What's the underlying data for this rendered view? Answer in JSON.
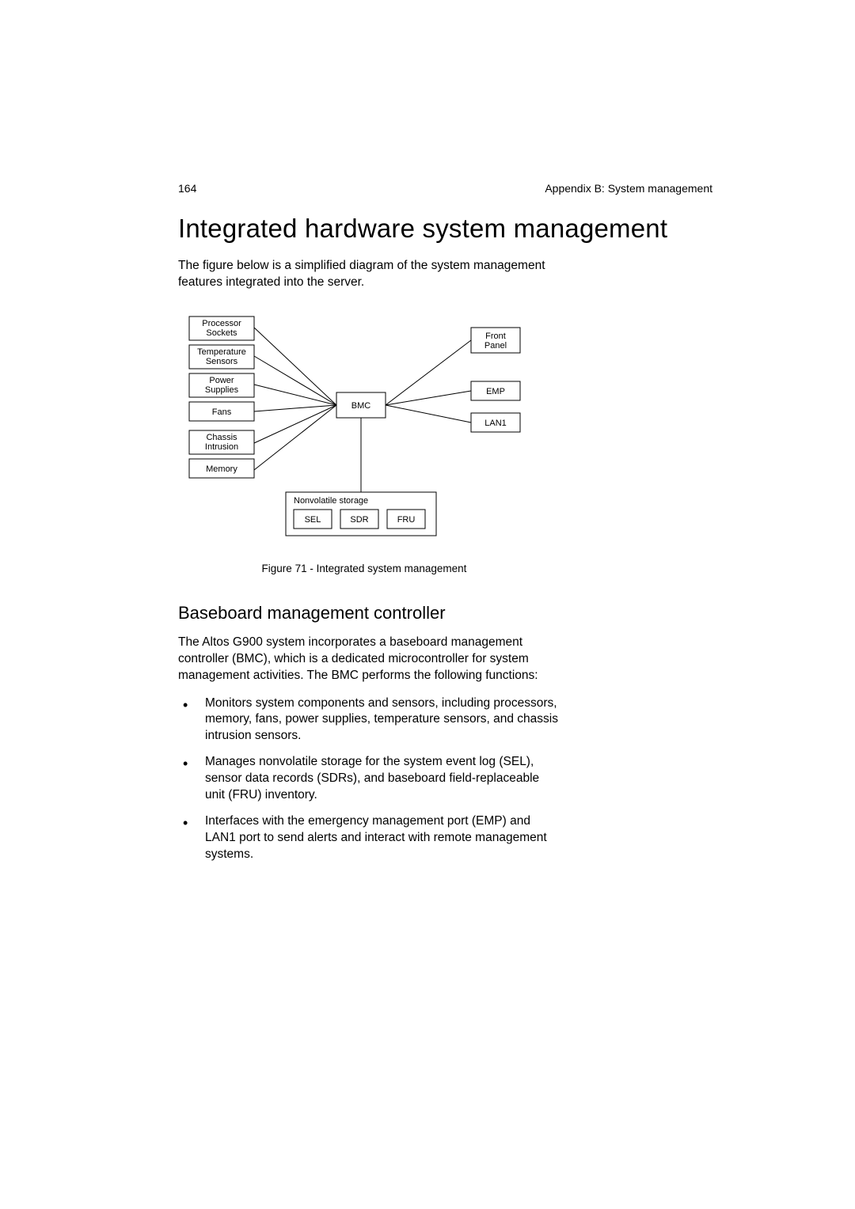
{
  "header": {
    "page_number": "164",
    "section": "Appendix B: System management"
  },
  "main": {
    "title": "Integrated hardware system management",
    "intro": "The figure below is a simplified diagram of the system management features integrated into the server.",
    "figure": {
      "caption": "Figure 71 - Integrated system management",
      "left_boxes": [
        "Processor Sockets",
        "Temperature Sensors",
        "Power Supplies",
        "Fans",
        "Chassis Intrusion",
        "Memory"
      ],
      "center_box": "BMC",
      "right_boxes": [
        "Front Panel",
        "EMP",
        "LAN1"
      ],
      "storage_group_label": "Nonvolatile storage",
      "storage_boxes": [
        "SEL",
        "SDR",
        "FRU"
      ]
    },
    "subheading": "Baseboard management controller",
    "body_para": "The Altos G900 system incorporates a baseboard management controller (BMC), which is a dedicated microcontroller for system management activities.  The BMC performs the following functions:",
    "bullets": [
      "Monitors system components and sensors, including processors, memory, fans, power supplies, temperature sensors, and chassis intrusion sensors.",
      "Manages nonvolatile storage for the system event log (SEL), sensor data records (SDRs), and baseboard field-replaceable unit (FRU) inventory.",
      "Interfaces with the emergency management port (EMP) and LAN1 port to send alerts and interact with remote management systems."
    ]
  }
}
